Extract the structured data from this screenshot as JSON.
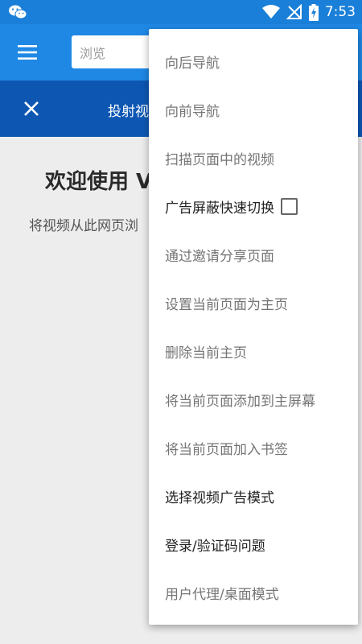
{
  "status_bar": {
    "time": "7:53",
    "left_icon": "wechat-icon",
    "icons": [
      "wifi-icon",
      "no-signal-icon",
      "battery-charging-icon"
    ]
  },
  "app_bar": {
    "search_placeholder": "浏览",
    "menu_icon": "hamburger-menu-icon"
  },
  "banner": {
    "title": "投射视",
    "close_icon": "close-icon"
  },
  "main": {
    "welcome": "欢迎使用 V",
    "hint": "将视频从此网页浏"
  },
  "menu": {
    "items": [
      {
        "label": "向后导航"
      },
      {
        "label": "向前导航"
      },
      {
        "label": "扫描页面中的视频"
      },
      {
        "label": "广告屏蔽快速切换",
        "checked": false
      },
      {
        "label": "通过邀请分享页面"
      },
      {
        "label": "设置当前页面为主页"
      },
      {
        "label": "删除当前主页"
      },
      {
        "label": "将当前页面添加到主屏幕"
      },
      {
        "label": "将当前页面加入书签"
      },
      {
        "label": "选择视频广告模式"
      },
      {
        "label": "登录/验证码问题"
      },
      {
        "label": "用户代理/桌面模式"
      }
    ]
  },
  "colors": {
    "status_bar": "#1a7fd8",
    "app_bar": "#1f88e5",
    "banner": "#0d57b3",
    "background": "#ededed"
  }
}
